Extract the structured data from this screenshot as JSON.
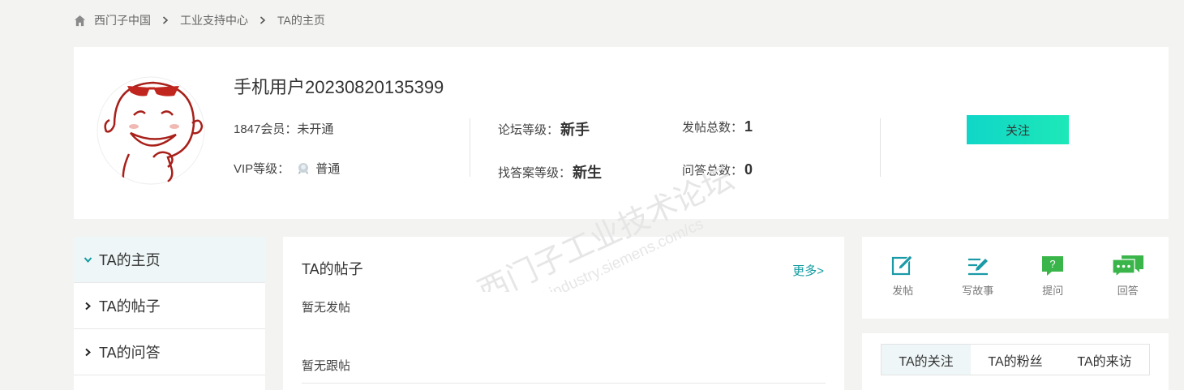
{
  "breadcrumb": {
    "home": "西门子中国",
    "level2": "工业支持中心",
    "current": "TA的主页"
  },
  "profile": {
    "username": "手机用户20230820135399",
    "member_label": "1847会员：",
    "member_value": "未开通",
    "vip_label": "VIP等级：",
    "vip_value": "普通",
    "forum_level_label": "论坛等级：",
    "forum_level_value": "新手",
    "answer_level_label": "找答案等级：",
    "answer_level_value": "新生",
    "posts_total_label": "发帖总数：",
    "posts_total_value": "1",
    "qa_total_label": "问答总数：",
    "qa_total_value": "0",
    "follow_button": "关注"
  },
  "left_nav": {
    "items": [
      {
        "label": "TA的主页",
        "active": true
      },
      {
        "label": "TA的帖子",
        "active": false
      },
      {
        "label": "TA的问答",
        "active": false
      }
    ]
  },
  "posts_panel": {
    "title": "TA的帖子",
    "more": "更多>",
    "no_posts": "暂无发帖",
    "no_replies": "暂无跟帖"
  },
  "actions": [
    {
      "label": "发帖",
      "icon": "edit-icon"
    },
    {
      "label": "写故事",
      "icon": "write-story-icon"
    },
    {
      "label": "提问",
      "icon": "question-icon"
    },
    {
      "label": "回答",
      "icon": "answer-icon"
    }
  ],
  "tabs": {
    "items": [
      "TA的关注",
      "TA的粉丝",
      "TA的来访"
    ],
    "active_index": 0
  },
  "watermark": {
    "line1": "西门子工业技术论坛",
    "line2": "support.industry.siemens.com/cs"
  },
  "colors": {
    "accent": "#119ba0",
    "follow_button_start": "#10d6c8",
    "follow_button_end": "#1de8b8",
    "icon_teal": "#1a9aa6",
    "icon_green": "#3ab54a"
  }
}
